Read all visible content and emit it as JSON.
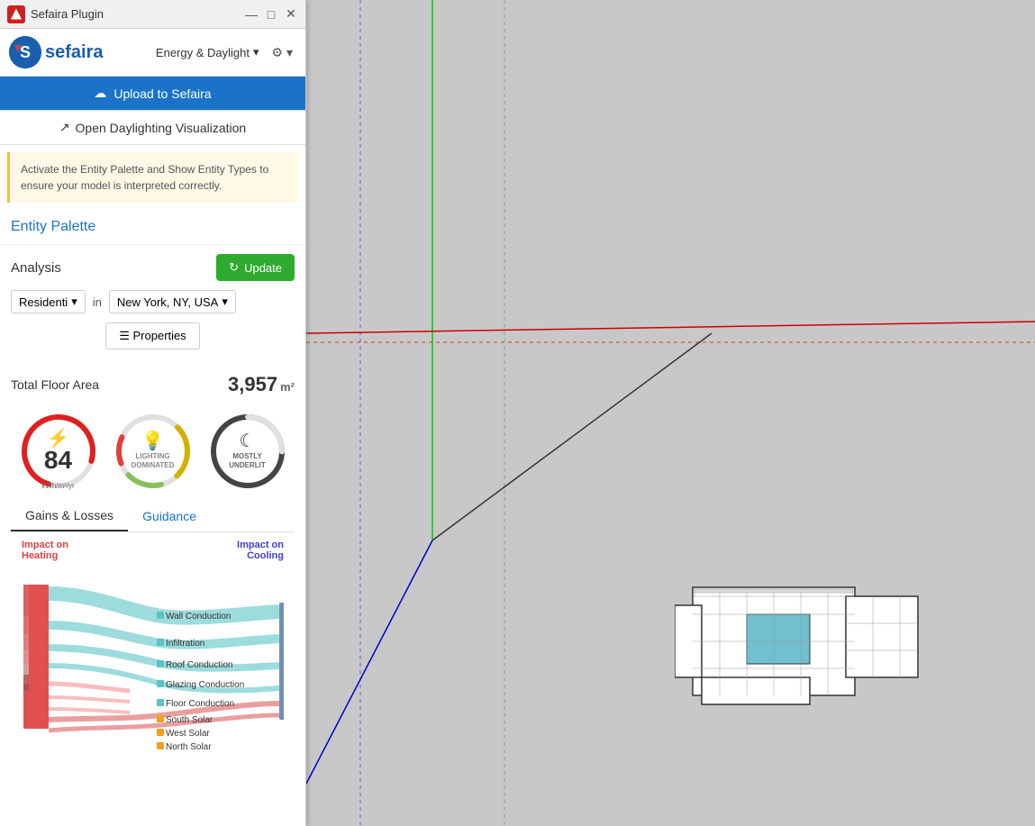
{
  "titlebar": {
    "app_name": "Sefaira Plugin",
    "minimize": "—",
    "maximize": "□",
    "close": "✕"
  },
  "header": {
    "logo_letter": "S",
    "brand_name": "sefaira",
    "energy_label": "Energy & Daylight",
    "dropdown_arrow": "▾",
    "gear_icon": "⚙",
    "settings_arrow": "▾"
  },
  "buttons": {
    "upload": "Upload to Sefaira",
    "daylighting": "Open Daylighting Visualization",
    "update": "Update",
    "properties": "☰  Properties"
  },
  "notice": {
    "text": "Activate the Entity Palette and Show Entity Types to ensure your model is interpreted correctly."
  },
  "entity_palette": {
    "label": "Entity Palette"
  },
  "analysis": {
    "label": "Analysis",
    "building_type": "Residenti",
    "in_text": "in",
    "location": "New York, NY, USA"
  },
  "metrics": {
    "floor_area_label": "Total Floor Area",
    "floor_area_value": "3,957",
    "floor_area_unit": "m²",
    "eui_value": "84",
    "eui_unit": "kWh/m²/yr",
    "lighting_label": "LIGHTING\nDOMINATED",
    "daylight_label": "MOSTLY\nUNDERLIT"
  },
  "tabs": {
    "gains_losses": "Gains & Losses",
    "guidance": "Guidance"
  },
  "gains_losses": {
    "impact_heating": "Impact on\nHeating",
    "impact_cooling": "Impact on\nCooling"
  },
  "legend": {
    "items": [
      {
        "label": "Wall Conduction",
        "color": "#5bc4c4"
      },
      {
        "label": "Infiltration",
        "color": "#5bc4c4"
      },
      {
        "label": "Roof Conduction",
        "color": "#5bc4c4"
      },
      {
        "label": "Glazing Conduction",
        "color": "#5bc4c4"
      },
      {
        "label": "Floor Conduction",
        "color": "#5bc4c4"
      },
      {
        "label": "South Solar",
        "color": "#f0a020"
      },
      {
        "label": "West Solar",
        "color": "#f0a020"
      },
      {
        "label": "North Solar",
        "color": "#f0a020"
      }
    ]
  }
}
